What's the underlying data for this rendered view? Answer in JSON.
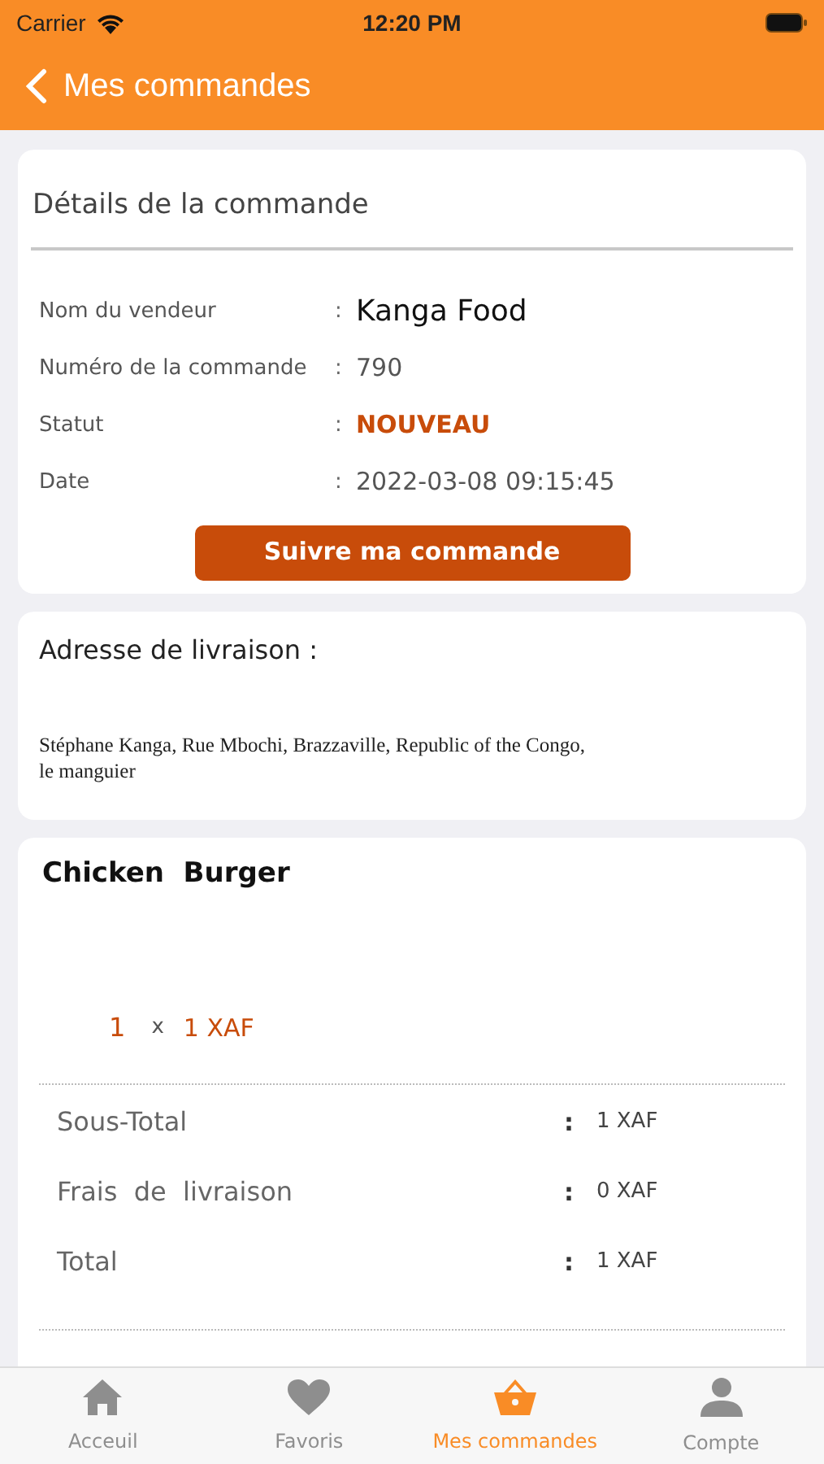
{
  "status_bar": {
    "carrier": "Carrier",
    "time": "12:20 PM"
  },
  "nav": {
    "back_label": "Mes commandes"
  },
  "details": {
    "title": "Détails de la commande",
    "rows": [
      {
        "label": "Nom du vendeur",
        "separator": ":",
        "value": "Kanga Food",
        "kind": "large"
      },
      {
        "label": "Numéro de la commande",
        "separator": ":",
        "value": "790",
        "kind": "plain"
      },
      {
        "label": "Statut",
        "separator": ":",
        "value": "NOUVEAU",
        "kind": "status"
      },
      {
        "label": "Date",
        "separator": ":",
        "value": "2022-03-08 09:15:45",
        "kind": "plain"
      }
    ],
    "button": "Suivre ma commande"
  },
  "address": {
    "title": "Adresse de livraison :",
    "lines": [
      "Stéphane Kanga, Rue Mbochi, Brazzaville, Republic of the Congo,",
      "le manguier"
    ]
  },
  "item": {
    "name": "Chicken  Burger",
    "quantity": "1",
    "times": "x",
    "price": "1 XAF"
  },
  "totals": [
    {
      "label": "Sous-Total",
      "separator": ":",
      "value": "1 XAF"
    },
    {
      "label": "Frais  de  livraison",
      "separator": ":",
      "value": "0 XAF"
    },
    {
      "label": "Total",
      "separator": ":",
      "value": "1 XAF"
    }
  ],
  "tabs": [
    {
      "label": "Acceuil",
      "selected": false
    },
    {
      "label": "Favoris",
      "selected": false
    },
    {
      "label": "Mes commandes",
      "selected": true
    },
    {
      "label": "Compte",
      "selected": false
    }
  ]
}
